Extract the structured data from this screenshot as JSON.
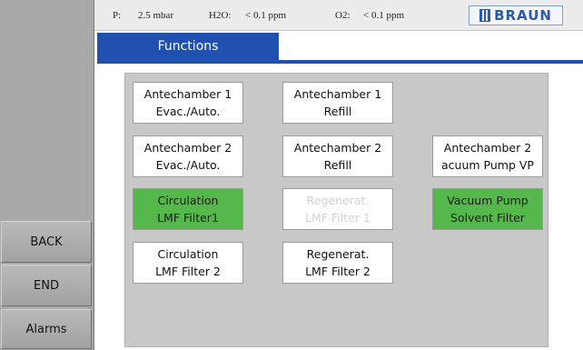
{
  "status": {
    "p_label": "P:",
    "p_value": "2.5 mbar",
    "h2o_label": "H2O:",
    "h2o_value": "< 0.1 ppm",
    "o2_label": "O2:",
    "o2_value": "< 0.1 ppm",
    "brand": "BRAUN"
  },
  "screen_title": "Functions",
  "sidebar": {
    "back": "BACK",
    "end": "END",
    "alarms": "Alarms"
  },
  "functions": {
    "ac1_evac": {
      "line1": "Antechamber 1",
      "line2": "Evac./Auto.",
      "state": "normal"
    },
    "ac1_refill": {
      "line1": "Antechamber 1",
      "line2": "Refill",
      "state": "normal"
    },
    "ac2_evac": {
      "line1": "Antechamber 2",
      "line2": "Evac./Auto.",
      "state": "normal"
    },
    "ac2_refill": {
      "line1": "Antechamber 2",
      "line2": "Refill",
      "state": "normal"
    },
    "ac2_vacuum": {
      "line1": "Antechamber 2",
      "line2": "acuum Pump VP",
      "state": "normal"
    },
    "circ1": {
      "line1": "Circulation",
      "line2": "LMF Filter1",
      "state": "active"
    },
    "regen1": {
      "line1": "Regenerat.",
      "line2": "LMF Filter 1",
      "state": "disabled"
    },
    "vac_pump": {
      "line1": "Vacuum Pump",
      "line2": "Solvent Filter",
      "state": "active"
    },
    "circ2": {
      "line1": "Circulation",
      "line2": "LMF Filter 2",
      "state": "normal"
    },
    "regen2": {
      "line1": "Regenerat.",
      "line2": "LMF Filter 2",
      "state": "normal"
    }
  },
  "colors": {
    "title_blue": "#2050b0",
    "active_green": "#55b84a",
    "panel_gray": "#c8c8c8",
    "sidebar_gray": "#a9a9a9",
    "brand_blue": "#2c5aa8"
  }
}
